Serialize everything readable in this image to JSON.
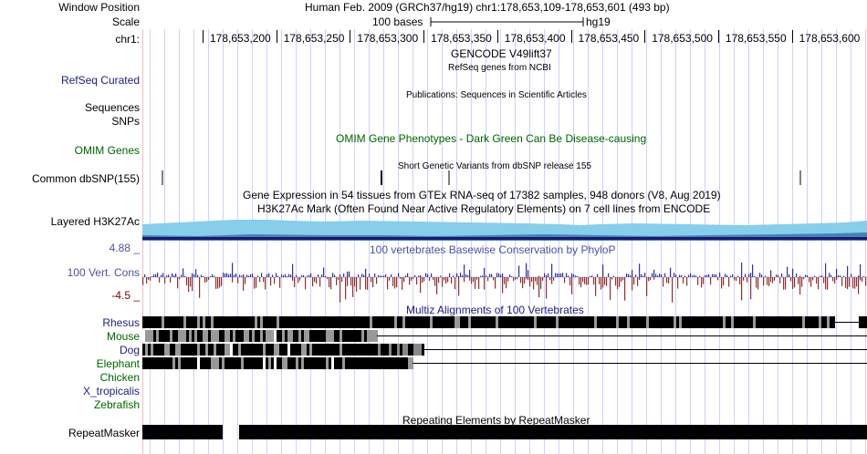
{
  "header": {
    "window_position_label": "Window Position",
    "window_position_title": "Human Feb. 2009 (GRCh37/hg19)   chr1:178,653,109-178,653,601 (493 bp)",
    "scale_label": "Scale",
    "scale_text": "100 bases",
    "scale_assembly": "hg19",
    "chrom_label": "chr1:",
    "ruler_ticks": [
      "178,653,200",
      "178,653,250",
      "178,653,300",
      "178,653,350",
      "178,653,400",
      "178,653,450",
      "178,653,500",
      "178,653,550",
      "178,653,600"
    ]
  },
  "tracks": {
    "gencode_title": "GENCODE V49lift37",
    "refseq_subtitle": "RefSeq genes from NCBI",
    "refseq_label": "RefSeq Curated",
    "publications_title": "Publications: Sequences in Scientific Articles",
    "sequences_label": "Sequences",
    "snps_label": "SNPs",
    "omim_label": "OMIM Genes",
    "omim_title": "OMIM Gene Phenotypes - Dark Green Can Be Disease-causing",
    "dbsnp_title": "Short Genetic Variants from dbSNP release 155",
    "dbsnp_label": "Common dbSNP(155)",
    "gtex_title": "Gene Expression in 54 tissues from GTEx RNA-seq of 17382 samples, 948 donors (V8, Aug 2019)",
    "h3k27ac_title": "H3K27Ac Mark (Often Found Near Active Regulatory Elements) on 7 cell lines from ENCODE",
    "h3k27ac_label": "Layered H3K27Ac",
    "cons_max": "4.88 _",
    "cons_title": "100 vertebrates Basewise Conservation by PhyloP",
    "cons_label": "100 Vert. Cons",
    "cons_min": "-4.5 _",
    "multiz_title": "Multiz Alignments of 100 Vertebrates",
    "species": [
      {
        "name": "Rhesus",
        "color": "navy"
      },
      {
        "name": "Mouse",
        "color": "green"
      },
      {
        "name": "Dog",
        "color": "navy"
      },
      {
        "name": "Elephant",
        "color": "green"
      },
      {
        "name": "Chicken",
        "color": "green"
      },
      {
        "name": "X_tropicalis",
        "color": "navy"
      },
      {
        "name": "Zebrafish",
        "color": "green"
      }
    ],
    "repeat_title": "Repeating Elements by RepeatMasker",
    "repeat_label": "RepeatMasker"
  },
  "colors": {
    "cons_positive": "#3030a0",
    "cons_negative": "#903030",
    "h3k27ac_light": "#87ceeb",
    "h3k27ac_dark": "#1a1a6e",
    "grid_line": "#d0d0ff",
    "base_line": "#f0c0c0"
  }
}
